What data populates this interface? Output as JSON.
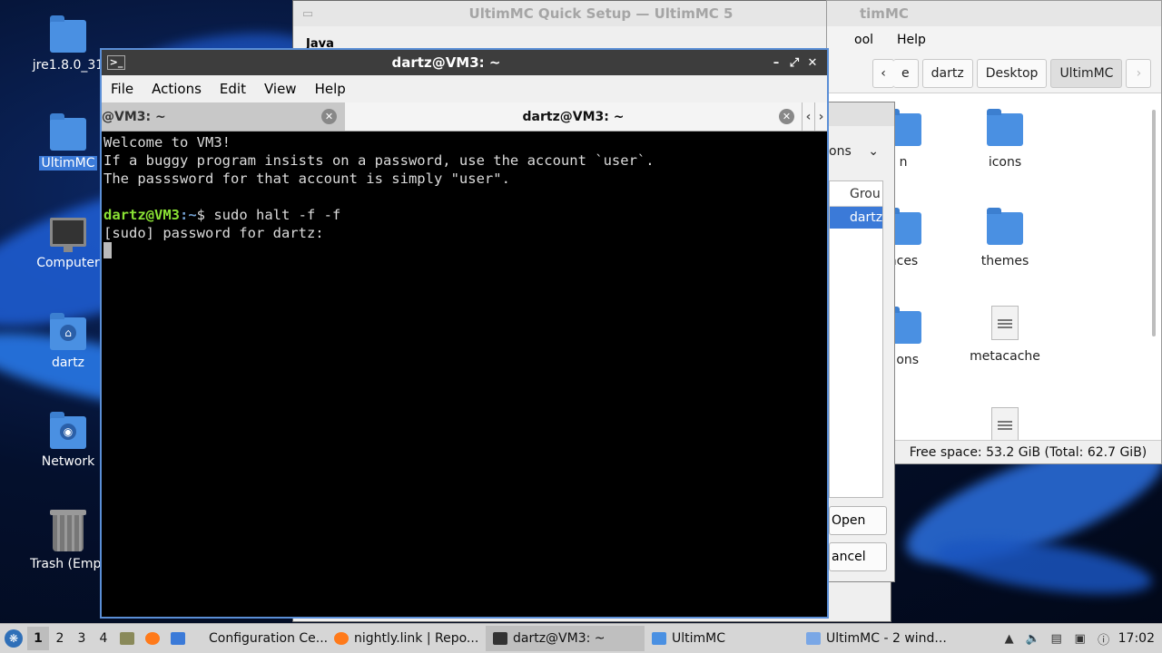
{
  "desktop": {
    "icons": [
      {
        "label": "jre1.8.0_31",
        "icon": "folder-icon"
      },
      {
        "label": "UltimMC",
        "icon": "folder-icon"
      },
      {
        "label": "Computer",
        "icon": "monitor-icon"
      },
      {
        "label": "dartz",
        "icon": "home-folder-icon"
      },
      {
        "label": "Network",
        "icon": "network-folder-icon"
      },
      {
        "label": "Trash (Empt",
        "icon": "trash-icon"
      }
    ]
  },
  "setup_window": {
    "title": "UltimMC Quick Setup — UltimMC 5",
    "tab": "Java"
  },
  "file_manager": {
    "title": "timMC",
    "menu": [
      "ool",
      "Help"
    ],
    "breadcrumb": [
      "e",
      "dartz",
      "Desktop",
      "UltimMC"
    ],
    "items": [
      {
        "label": "n",
        "type": "folder"
      },
      {
        "label": "icons",
        "type": "folder"
      },
      {
        "label": "nces",
        "type": "folder"
      },
      {
        "label": "themes",
        "type": "folder"
      },
      {
        "label": "tions",
        "type": "folder"
      },
      {
        "label": "metacache",
        "type": "file"
      }
    ],
    "status": "Free space: 53.2 GiB (Total: 62.7 GiB)"
  },
  "dialog": {
    "combo": "ons",
    "column_header": "Grou",
    "selected_row": "dartz",
    "open_label": "Open",
    "cancel_label": "ancel"
  },
  "terminal": {
    "title": "dartz@VM3: ~",
    "menu": [
      "File",
      "Actions",
      "Edit",
      "View",
      "Help"
    ],
    "tabs": [
      {
        "label": "@VM3: ~",
        "active": false
      },
      {
        "label": "dartz@VM3: ~",
        "active": true
      }
    ],
    "lines": [
      "Welcome to VM3!",
      "If a buggy program insists on a password, use the account `user`.",
      "The passsword for that account is simply \"user\".",
      ""
    ],
    "prompt_user": "dartz@VM3",
    "prompt_path": ":~",
    "prompt_symbol": "$ ",
    "command": "sudo halt -f -f",
    "sudo_line": "[sudo] password for dartz:"
  },
  "taskbar": {
    "workspaces": [
      "1",
      "2",
      "3",
      "4"
    ],
    "tasks": [
      {
        "label": "Configuration Ce...",
        "icon": "settings-icon",
        "active": false
      },
      {
        "label": "nightly.link | Repo...",
        "icon": "firefox-icon",
        "active": false
      },
      {
        "label": "dartz@VM3: ~",
        "icon": "terminal-icon",
        "active": true
      },
      {
        "label": "UltimMC",
        "icon": "folder-icon",
        "active": false
      },
      {
        "label": "UltimMC - 2 wind...",
        "icon": "window-icon",
        "active": false
      }
    ],
    "clock": "17:02"
  },
  "colors": {
    "accent": "#3b7ad8",
    "terminal_prompt_user": "#8ae234",
    "terminal_prompt_path": "#729fcf"
  }
}
